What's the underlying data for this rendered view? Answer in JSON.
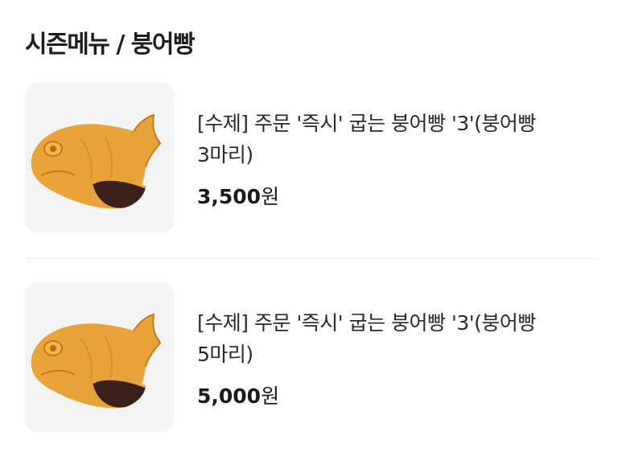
{
  "section": {
    "title": "시즌메뉴 / 붕어빵"
  },
  "products": [
    {
      "name_line1": "[수제] 주문 '즉시' 굽는 붕어빵 '3'(붕어빵",
      "name_line2": "3마리)",
      "price_value": "3,500",
      "price_unit": "원",
      "image_icon": "fish-bread-icon"
    },
    {
      "name_line1": "[수제] 주문 '즉시' 굽는 붕어빵 '3'(붕어빵",
      "name_line2": "5마리)",
      "price_value": "5,000",
      "price_unit": "원",
      "image_icon": "fish-bread-icon"
    }
  ],
  "colors": {
    "bread": "#e8a43a",
    "bread_dark": "#c9781e",
    "filling": "#3b1f1a",
    "thumb_bg": "#f4f4f4"
  }
}
